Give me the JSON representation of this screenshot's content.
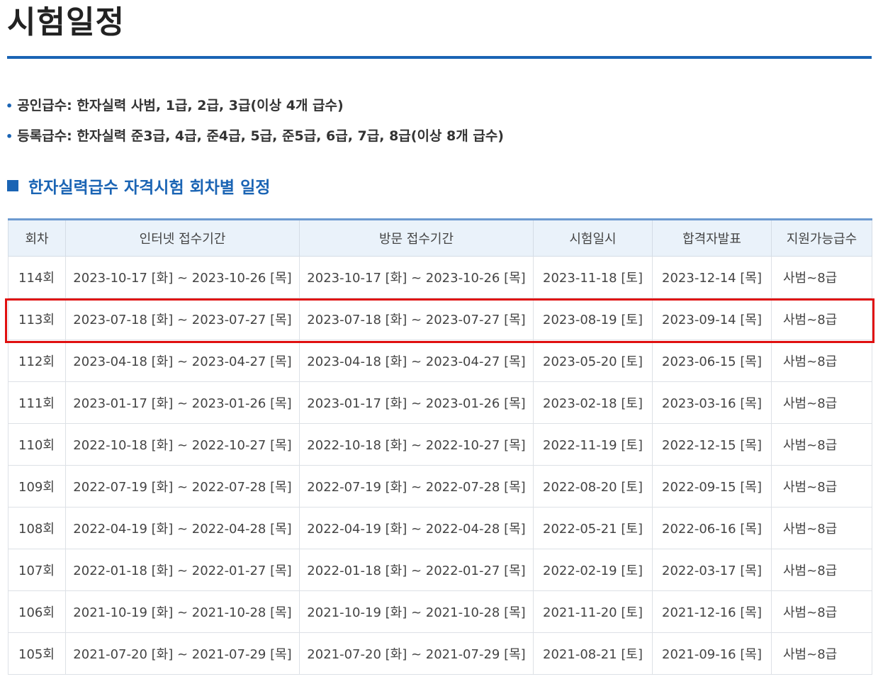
{
  "page": {
    "title": "시험일정",
    "info": [
      "공인급수: 한자실력 사범, 1급, 2급, 3급(이상 4개 급수)",
      "등록급수: 한자실력 준3급, 4급, 준4급, 5급, 준5급, 6급, 7급, 8급(이상 8개 급수)"
    ],
    "section_title": "한자실력급수 자격시험 회차별 일정"
  },
  "table": {
    "headers": [
      "회차",
      "인터넷 접수기간",
      "방문 접수기간",
      "시험일시",
      "합격자발표",
      "지원가능급수"
    ],
    "rows": [
      [
        "114회",
        "2023-10-17 [화] ~ 2023-10-26 [목]",
        "2023-10-17 [화] ~ 2023-10-26 [목]",
        "2023-11-18 [토]",
        "2023-12-14 [목]",
        "사범~8급"
      ],
      [
        "113회",
        "2023-07-18 [화] ~ 2023-07-27 [목]",
        "2023-07-18 [화] ~ 2023-07-27 [목]",
        "2023-08-19 [토]",
        "2023-09-14 [목]",
        "사범~8급"
      ],
      [
        "112회",
        "2023-04-18 [화] ~ 2023-04-27 [목]",
        "2023-04-18 [화] ~ 2023-04-27 [목]",
        "2023-05-20 [토]",
        "2023-06-15 [목]",
        "사범~8급"
      ],
      [
        "111회",
        "2023-01-17 [화] ~ 2023-01-26 [목]",
        "2023-01-17 [화] ~ 2023-01-26 [목]",
        "2023-02-18 [토]",
        "2023-03-16 [목]",
        "사범~8급"
      ],
      [
        "110회",
        "2022-10-18 [화] ~ 2022-10-27 [목]",
        "2022-10-18 [화] ~ 2022-10-27 [목]",
        "2022-11-19 [토]",
        "2022-12-15 [목]",
        "사범~8급"
      ],
      [
        "109회",
        "2022-07-19 [화] ~ 2022-07-28 [목]",
        "2022-07-19 [화] ~ 2022-07-28 [목]",
        "2022-08-20 [토]",
        "2022-09-15 [목]",
        "사범~8급"
      ],
      [
        "108회",
        "2022-04-19 [화] ~ 2022-04-28 [목]",
        "2022-04-19 [화] ~ 2022-04-28 [목]",
        "2022-05-21 [토]",
        "2022-06-16 [목]",
        "사범~8급"
      ],
      [
        "107회",
        "2022-01-18 [화] ~ 2022-01-27 [목]",
        "2022-01-18 [화] ~ 2022-01-27 [목]",
        "2022-02-19 [토]",
        "2022-03-17 [목]",
        "사범~8급"
      ],
      [
        "106회",
        "2021-10-19 [화] ~ 2021-10-28 [목]",
        "2021-10-19 [화] ~ 2021-10-28 [목]",
        "2021-11-20 [토]",
        "2021-12-16 [목]",
        "사범~8급"
      ],
      [
        "105회",
        "2021-07-20 [화] ~ 2021-07-29 [목]",
        "2021-07-20 [화] ~ 2021-07-29 [목]",
        "2021-08-21 [토]",
        "2021-09-16 [목]",
        "사범~8급"
      ]
    ]
  },
  "colors": {
    "accent": "#1a64b4",
    "header_bg": "#eaf2fa",
    "highlight": "#e01010"
  }
}
